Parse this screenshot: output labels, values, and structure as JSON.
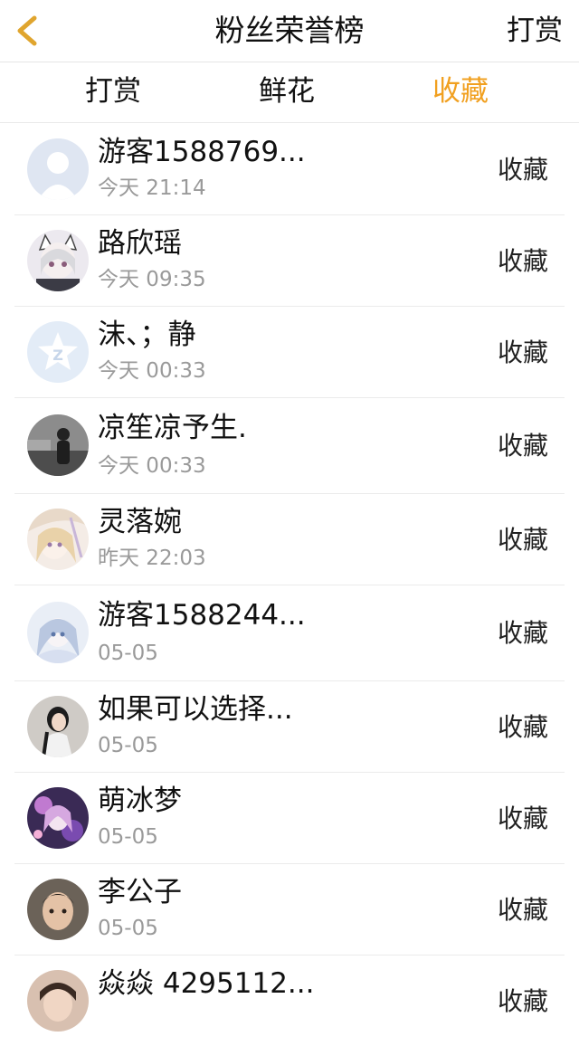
{
  "header": {
    "title": "粉丝荣誉榜",
    "right_action": "打赏",
    "accent": "#f1a020"
  },
  "tabs": [
    {
      "label": "打赏",
      "active": false
    },
    {
      "label": "鲜花",
      "active": false
    },
    {
      "label": "收藏",
      "active": true
    }
  ],
  "rows": [
    {
      "name": "游客1588769...",
      "time": "今天 21:14",
      "action": "收藏",
      "avatar": "default-avatar"
    },
    {
      "name": "路欣瑶",
      "time": "今天 09:35",
      "action": "收藏",
      "avatar": "anime-avatar"
    },
    {
      "name": "沫、；静",
      "time": "今天 00:33",
      "action": "收藏",
      "avatar": "qq-avatar"
    },
    {
      "name": "凉笙凉予生.",
      "time": "今天 00:33",
      "action": "收藏",
      "avatar": "photo-avatar"
    },
    {
      "name": "灵落婉",
      "time": "昨天 22:03",
      "action": "收藏",
      "avatar": "anime-avatar"
    },
    {
      "name": "游客1588244...",
      "time": "05-05",
      "action": "收藏",
      "avatar": "anime-avatar"
    },
    {
      "name": "如果可以选择...",
      "time": "05-05",
      "action": "收藏",
      "avatar": "photo-avatar"
    },
    {
      "name": "萌冰梦",
      "time": "05-05",
      "action": "收藏",
      "avatar": "anime-avatar"
    },
    {
      "name": "李公子",
      "time": "05-05",
      "action": "收藏",
      "avatar": "photo-avatar"
    },
    {
      "name": "焱焱 4295112...",
      "time": "",
      "action": "收藏",
      "avatar": "photo-avatar"
    }
  ]
}
